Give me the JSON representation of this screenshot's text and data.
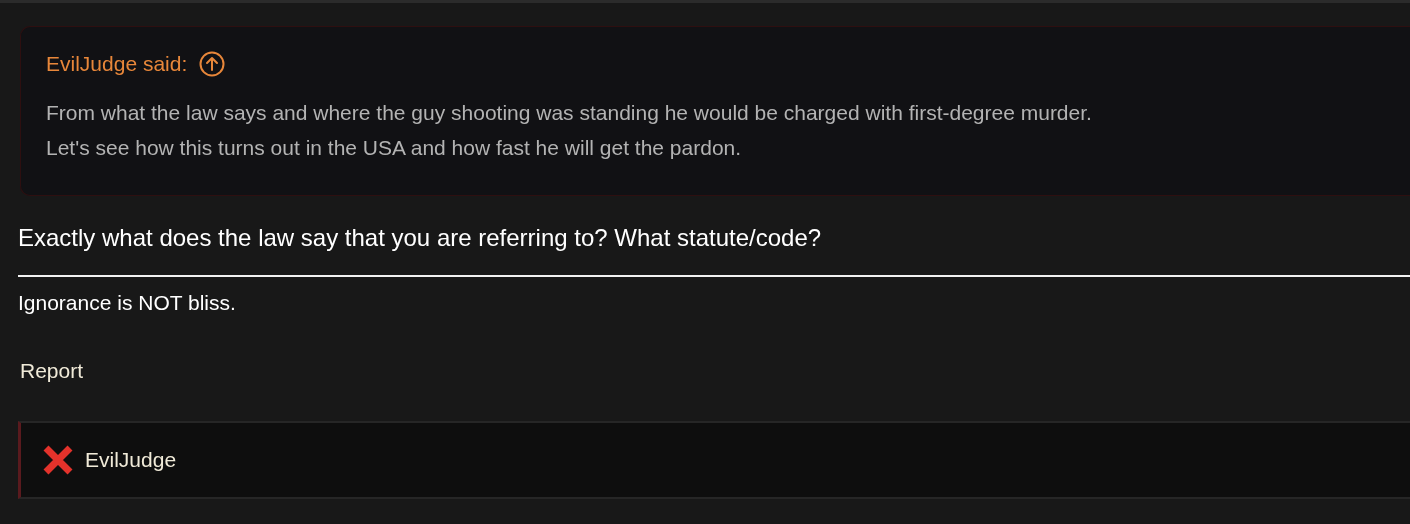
{
  "quote": {
    "author": "EvilJudge said:",
    "lines": [
      "From what the law says and where the guy shooting was standing he would be charged with first-degree murder.",
      "Let's see how this turns out in the USA and how fast he will get the pardon."
    ]
  },
  "reply": "Exactly what does the law say that you are referring to? What statute/code?",
  "signature": "Ignorance is NOT bliss.",
  "report": "Report",
  "ignored_user": {
    "name": "EvilJudge"
  }
}
